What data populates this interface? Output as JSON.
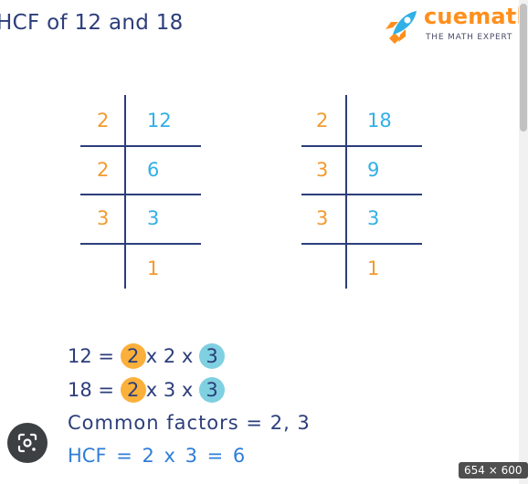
{
  "title": "HCF of 12 and 18",
  "logo": {
    "name": "cuemath",
    "tagline": "THE MATH EXPERT"
  },
  "table12": {
    "rows": [
      {
        "divisor": "2",
        "value": "12"
      },
      {
        "divisor": "2",
        "value": "6"
      },
      {
        "divisor": "3",
        "value": "3"
      },
      {
        "divisor": "",
        "value": "1"
      }
    ]
  },
  "table18": {
    "rows": [
      {
        "divisor": "2",
        "value": "18"
      },
      {
        "divisor": "3",
        "value": "9"
      },
      {
        "divisor": "3",
        "value": "3"
      },
      {
        "divisor": "",
        "value": "1"
      }
    ]
  },
  "factorization12": {
    "lhs": "12",
    "eq": "=",
    "f1": "2",
    "x1": "x",
    "f2": "2",
    "x2": "x",
    "f3": "3"
  },
  "factorization18": {
    "lhs": "18",
    "eq": "=",
    "f1": "2",
    "x1": "x",
    "f2": "3",
    "x2": "x",
    "f3": "3"
  },
  "common": {
    "label": "Common factors",
    "eq": "=",
    "value": "2, 3"
  },
  "hcf": {
    "text": "HCF = 2 x 3 = 6"
  },
  "image_size_badge": "654 × 600",
  "colors": {
    "navy": "#2c3e7a",
    "orange": "#f29a2e",
    "blue": "#31b0e6",
    "circle_orange": "#fbb03b",
    "circle_blue": "#7fd0e0",
    "hcf_blue": "#2f7ed8"
  }
}
